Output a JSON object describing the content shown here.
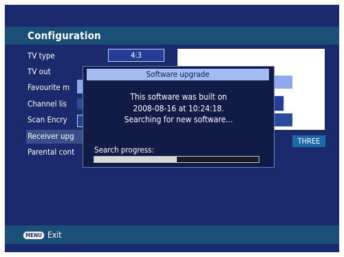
{
  "screen": {
    "title": "Configuration",
    "menu": [
      {
        "label": "TV type"
      },
      {
        "label": "TV out"
      },
      {
        "label": "Favourite m"
      },
      {
        "label": "Channel lis"
      },
      {
        "label": "Scan Encry"
      },
      {
        "label": "Receiver upg"
      },
      {
        "label": "Parental cont"
      }
    ],
    "tv_type_value": "4:3",
    "three_label": "THREE"
  },
  "dialog": {
    "title": "Software upgrade",
    "line1": "This software was built on",
    "line2": "2008-08-16 at 10:24:18.",
    "line3": "Searching for new software...",
    "progress_label": "Search progress:",
    "progress_fraction": 0.5
  },
  "footer": {
    "menu_key": "MENU",
    "exit_label": "Exit"
  }
}
